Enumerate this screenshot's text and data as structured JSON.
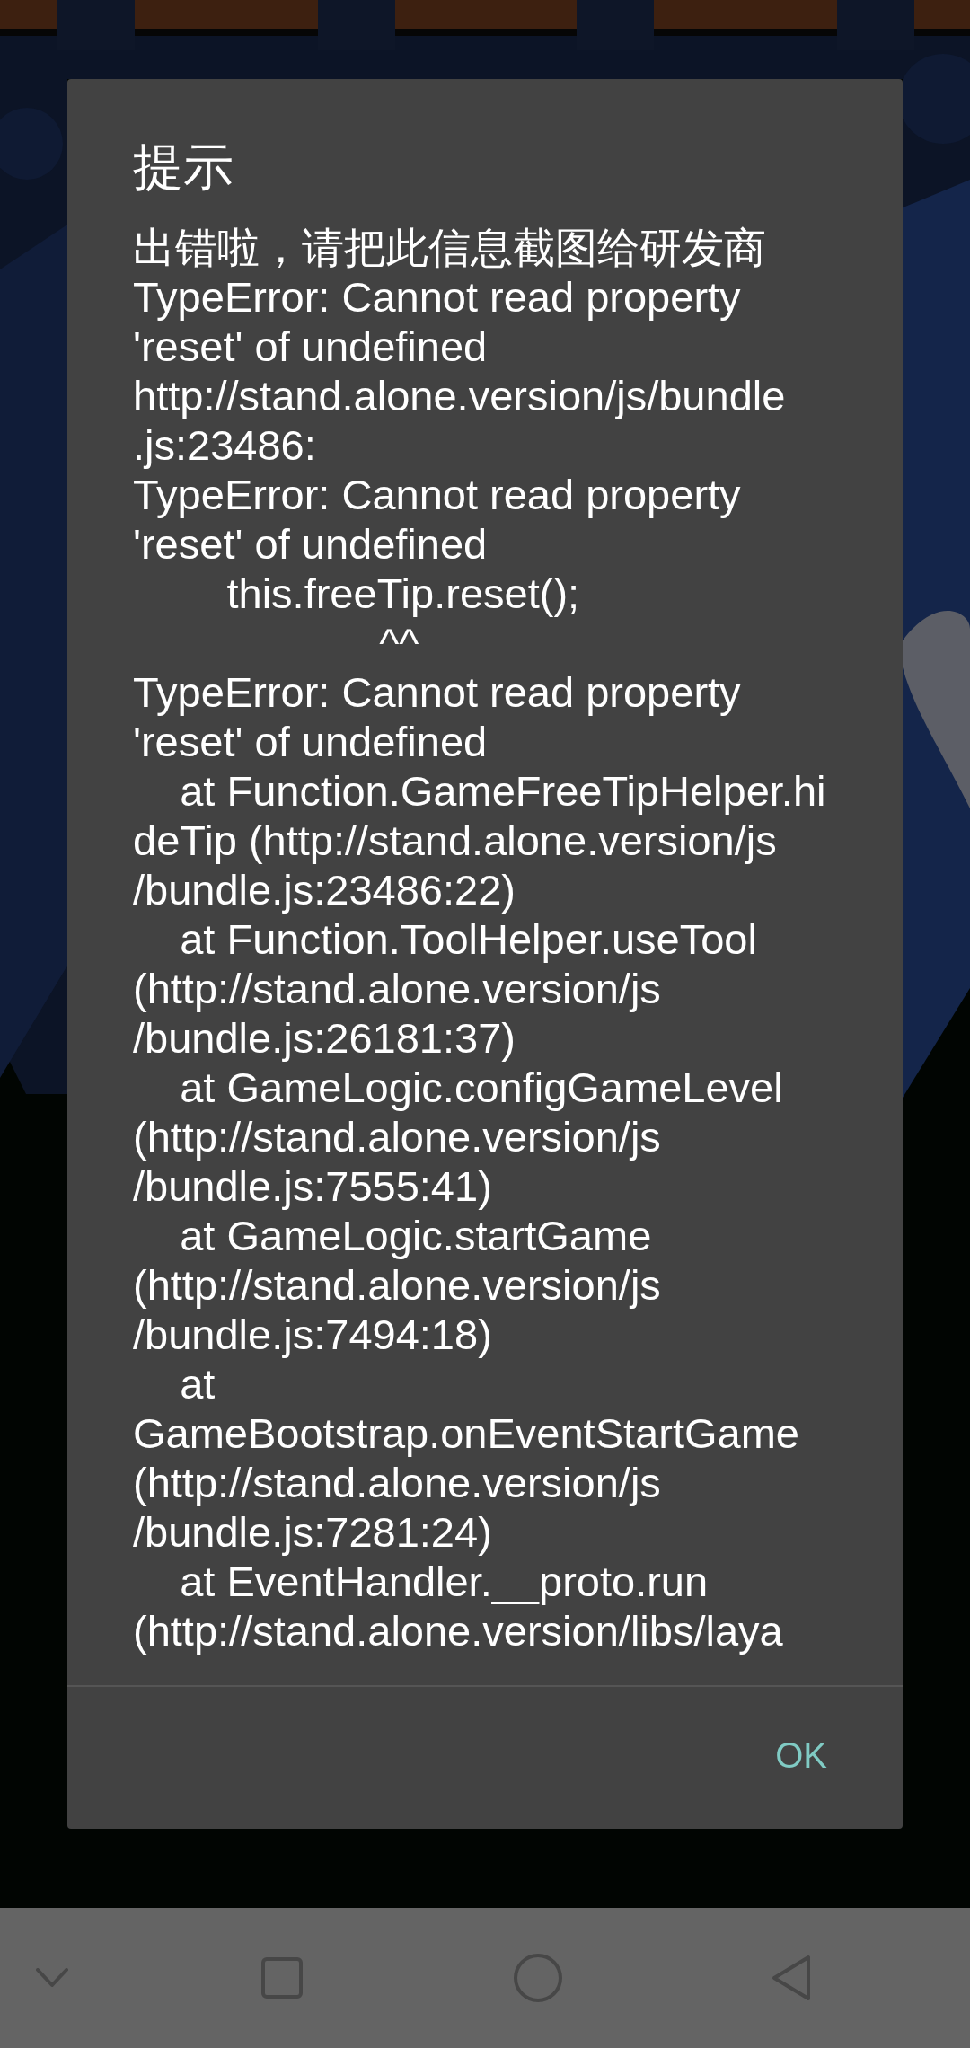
{
  "dialog": {
    "title": "提示",
    "message": "出错啦，请把此信息截图给研发商\nTypeError: Cannot read property\n'reset' of undefined\nhttp://stand.alone.version/js/bundle\n.js:23486:\nTypeError: Cannot read property\n'reset' of undefined\n        this.freeTip.reset();\n                     ^^\nTypeError: Cannot read property\n'reset' of undefined\n    at Function.GameFreeTipHelper.hi\ndeTip (http://stand.alone.version/js\n/bundle.js:23486:22)\n    at Function.ToolHelper.useTool\n(http://stand.alone.version/js\n/bundle.js:26181:37)\n    at GameLogic.configGameLevel\n(http://stand.alone.version/js\n/bundle.js:7555:41)\n    at GameLogic.startGame\n(http://stand.alone.version/js\n/bundle.js:7494:18)\n    at\nGameBootstrap.onEventStartGame\n(http://stand.alone.version/js\n/bundle.js:7281:24)\n    at EventHandler.__proto.run\n(http://stand.alone.version/libs/laya",
    "buttons": [
      "OK"
    ]
  },
  "nav_bar": {
    "kind": "three-button"
  }
}
